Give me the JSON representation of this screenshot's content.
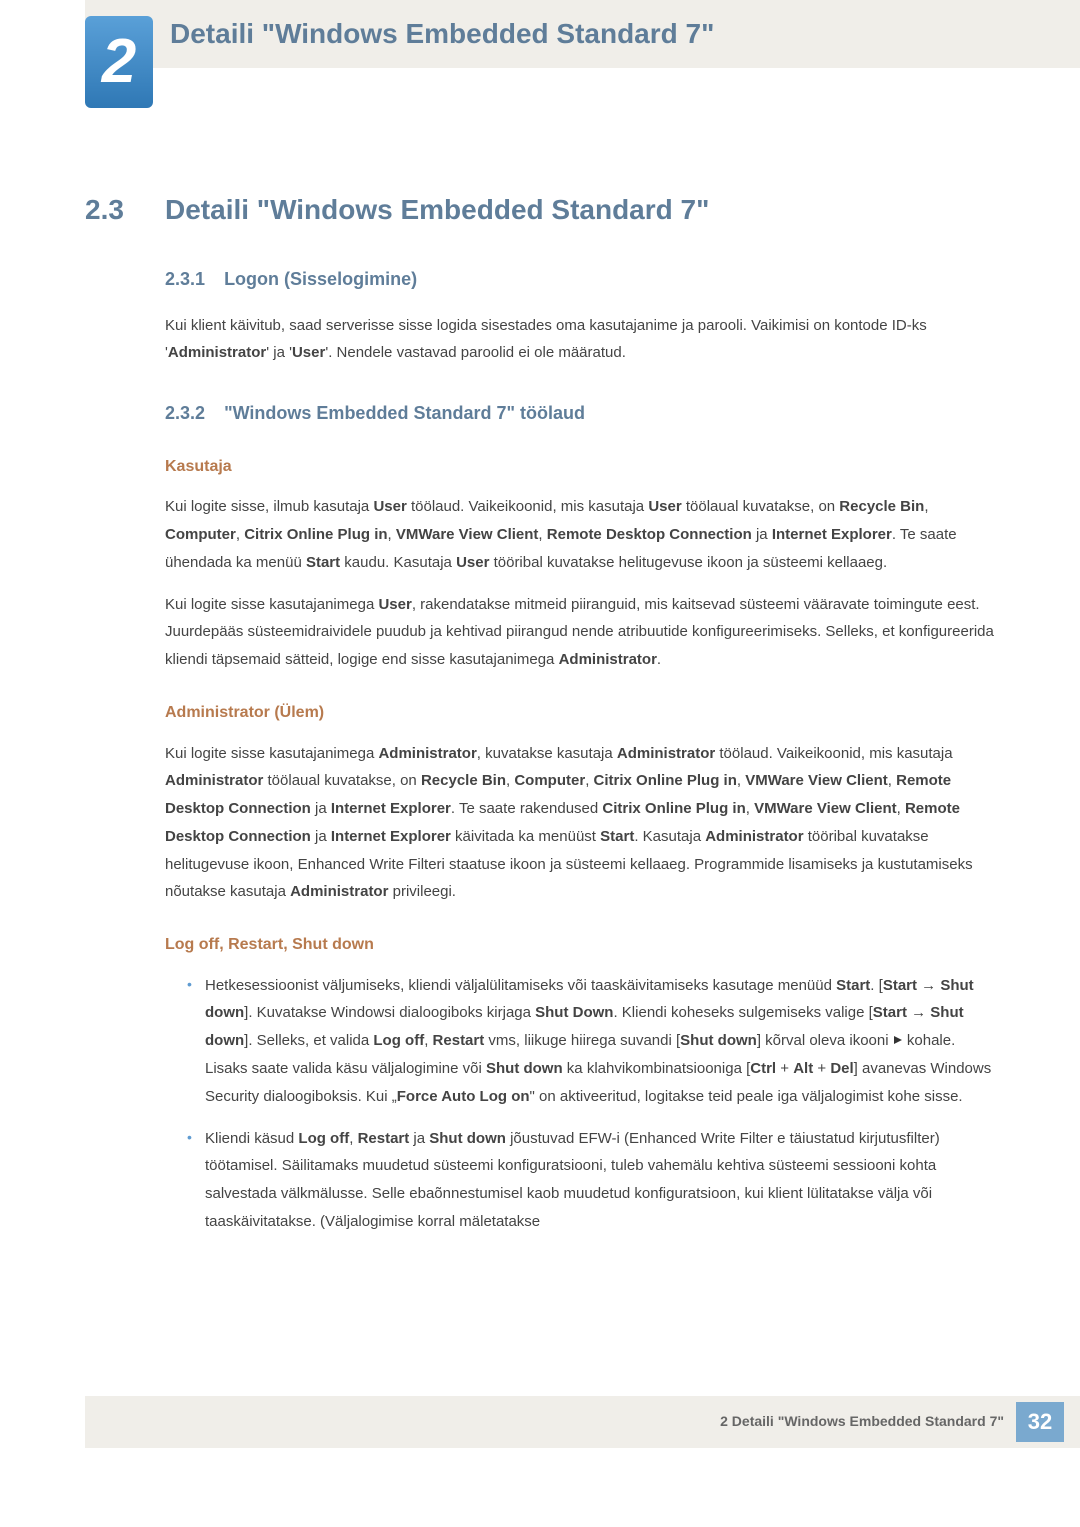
{
  "chapter": {
    "number": "2",
    "title": "Detaili \"Windows Embedded Standard 7\""
  },
  "section": {
    "number": "2.3",
    "title": "Detaili \"Windows Embedded Standard 7\""
  },
  "sub231": {
    "number": "2.3.1",
    "title": "Logon (Sisselogimine)",
    "para": "Kui klient käivitub, saad serverisse sisse logida sisestades oma kasutajanime ja parooli. Vaikimisi on kontode ID-ks 'Administrator' ja 'User'. Nendele vastavad paroolid ei ole määratud."
  },
  "sub232": {
    "number": "2.3.2",
    "title": "\"Windows Embedded Standard 7\" töölaud",
    "kasutaja": {
      "heading": "Kasutaja",
      "p1": "Kui logite sisse, ilmub kasutaja User töölaud. Vaikeikoonid, mis kasutaja User töölaual kuvatakse, on Recycle Bin, Computer, Citrix Online Plug in, VMWare View Client, Remote Desktop Connection ja Internet Explorer. Te saate ühendada ka menüü Start kaudu. Kasutaja User tööribal kuvatakse helitugevuse ikoon ja süsteemi kellaaeg.",
      "p2": "Kui logite sisse kasutajanimega User, rakendatakse mitmeid piiranguid, mis kaitsevad süsteemi vääravate toimingute eest. Juurdepääs süsteemidraividele puudub ja kehtivad piirangud nende atribuutide konfigureerimiseks. Selleks, et konfigureerida kliendi täpsemaid sätteid, logige end sisse kasutajanimega Administrator."
    },
    "admin": {
      "heading": "Administrator (Ülem)",
      "p1": "Kui logite sisse kasutajanimega Administrator, kuvatakse kasutaja Administrator töölaud. Vaikeikoonid, mis kasutaja Administrator töölaual kuvatakse, on Recycle Bin, Computer, Citrix Online Plug in, VMWare View Client, Remote Desktop Connection ja Internet Explorer. Te saate rakendused Citrix Online Plug in, VMWare View Client, Remote Desktop Connection ja Internet Explorer käivitada ka menüüst Start. Kasutaja Administrator tööribal kuvatakse helitugevuse ikoon, Enhanced Write Filteri staatuse ikoon ja süsteemi kellaaeg. Programmide lisamiseks ja kustutamiseks nõutakse kasutaja Administrator privileegi."
    },
    "logoff": {
      "heading": "Log off, Restart, Shut down",
      "li1": "Hetkesessioonist väljumiseks, kliendi väljalülitamiseks või taaskäivitamiseks kasutage menüüd Start. [Start → Shut down]. Kuvatakse Windowsi dialoogiboks kirjaga Shut Down. Kliendi koheseks sulgemiseks valige [Start → Shut down]. Selleks, et valida Log off, Restart vms, liikuge hiirega suvandi [Shut down] kõrval oleva ikooni ▶ kohale. Lisaks saate valida käsu väljalogimine või Shut down ka klahvikombinatsiooniga [Ctrl + Alt + Del] avanevas Windows Security dialoogiboksis. Kui „Force Auto Log on\" on aktiveeritud, logitakse teid peale iga väljalogimist kohe sisse.",
      "li2": "Kliendi käsud Log off, Restart ja Shut down jõustuvad EFW-i (Enhanced Write Filter e täiustatud kirjutusfilter) töötamisel. Säilitamaks muudetud süsteemi konfiguratsiooni, tuleb vahemälu kehtiva süsteemi sessiooni kohta salvestada välkmälusse. Selle ebaõnnestumisel kaob muudetud konfiguratsioon, kui klient lülitatakse välja või taaskäivitatakse. (Väljalogimise korral mäletatakse"
    }
  },
  "footer": {
    "text": "2 Detaili \"Windows Embedded Standard 7\"",
    "page": "32"
  }
}
